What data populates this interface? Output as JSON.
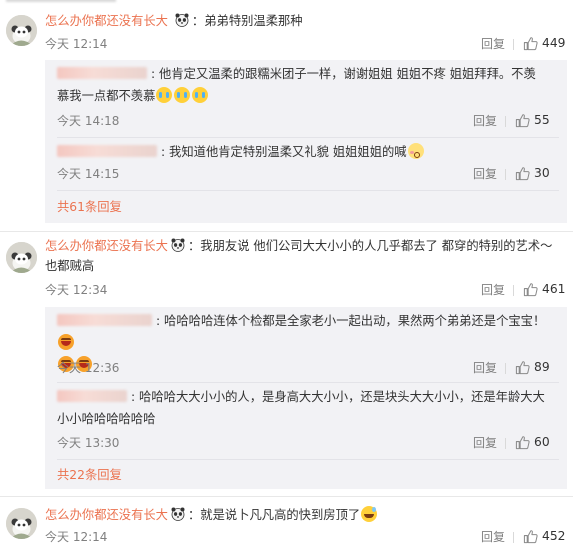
{
  "comments": [
    {
      "username": "怎么办你都还没有长大",
      "text": "弟弟特别温柔那种",
      "time": "今天 12:14",
      "reply_label": "回复",
      "likes": "449"
    },
    {
      "username": "怎么办你都还没有长大",
      "text": "我朋友说 他们公司大大小小的人几乎都去了 都穿的特别的艺术～也都贼高",
      "time": "今天 12:34",
      "reply_label": "回复",
      "likes": "461"
    },
    {
      "username": "怎么办你都还没有长大",
      "text": "就是说卜凡凡高的快到房顶了",
      "time": "今天 12:14",
      "reply_label": "回复",
      "likes": "452"
    }
  ],
  "replies_1": [
    {
      "text": ": 他肯定又温柔的跟糯米团子一样，谢谢姐姐 姐姐不疼 姐姐拜拜。不羡慕我一点都不羡慕",
      "time": "今天 14:18",
      "reply_label": "回复",
      "likes": "55"
    },
    {
      "text": ": 我知道他肯定特别温柔又礼貌 姐姐姐姐的喊",
      "time": "今天 14:15",
      "reply_label": "回复",
      "likes": "30"
    }
  ],
  "replies_1_more": "共61条回复",
  "replies_2": [
    {
      "text": ": 哈哈哈哈连体个检都是全家老小一起出动，果然两个弟弟还是个宝宝！",
      "time": "今天 12:36",
      "reply_label": "回复",
      "likes": "89"
    },
    {
      "text": ": 哈哈哈大大小小的人，是身高大大小小，还是块头大大小小，还是年龄大大小小哈哈哈哈哈哈",
      "time": "今天 13:30",
      "reply_label": "回复",
      "likes": "60"
    }
  ],
  "replies_2_more": "共22条回复",
  "colors": {
    "accent": "#eb7350",
    "subbox": "#f2f2f5",
    "meta": "#808080"
  },
  "icons": [
    "avatar-panda-icon",
    "panda-emoji-icon",
    "thumbs-up-icon",
    "crying-emoji-icon",
    "laughing-emoji-icon",
    "sweat-smile-emoji-icon",
    "shy-emoji-icon"
  ]
}
